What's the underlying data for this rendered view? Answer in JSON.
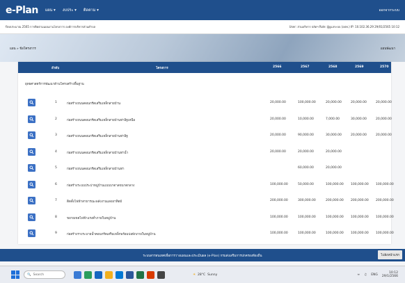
{
  "app": {
    "logo": "e-Plan",
    "nav": [
      "แผน",
      "งบประ",
      "ติดตาม"
    ],
    "top_right": "ออกจากระบบ"
  },
  "info": {
    "left": "ปีงบประมาณ 2565   การติดตามแผนงานโครงการ องค์การบริหารส่วนตำบล",
    "right": "User: ส่วนบริหาร ปลัดฯ  Role: ผู้ดูแลระบบ (อปท.)  IP: 10.102.36.29  29/01/2565 10:12"
  },
  "breadcrumb": {
    "left": "แผน » ข้อโครงการ",
    "right": "แผนพัฒนา"
  },
  "table": {
    "headers": {
      "seq": "ลำดับ",
      "name": "โครงการ",
      "y1": "2566",
      "y2": "2567",
      "y3": "2568",
      "y4": "2569",
      "y5": "2570"
    },
    "group_label": "ยุทธศาสตร์การพัฒนาด้านโครงสร้างพื้นฐาน",
    "rows": [
      {
        "no": "1",
        "name": "ก่อสร้างถนนคอนกรีตเสริมเหล็กสายบ้าน",
        "v1": "20,000.00",
        "v2": "100,000.00",
        "v3": "20,000.00",
        "v4": "20,000.00",
        "v5": "20,000.00"
      },
      {
        "no": "2",
        "name": "ก่อสร้างถนนคอนกรีตเสริมเหล็กสายบ้านท่าอิฐเหนือ",
        "v1": "20,000.00",
        "v2": "10,000.00",
        "v3": "7,000.00",
        "v4": "30,000.00",
        "v5": "20,000.00"
      },
      {
        "no": "3",
        "name": "ก่อสร้างถนนคอนกรีตเสริมเหล็กสายบ้านท่าอิฐ",
        "v1": "20,000.00",
        "v2": "90,000.00",
        "v3": "30,000.00",
        "v4": "20,000.00",
        "v5": "20,000.00"
      },
      {
        "no": "4",
        "name": "ก่อสร้างถนนคอนกรีตเสริมเหล็กสายบ้านท่าน้ำ",
        "v1": "20,000.00",
        "v2": "20,000.00",
        "v3": "20,000.00",
        "v4": "",
        "v5": ""
      },
      {
        "no": "5",
        "name": "ก่อสร้างถนนคอนกรีตเสริมเหล็กสายบ้านท่า",
        "v1": "",
        "v2": "60,000.00",
        "v3": "20,000.00",
        "v4": "",
        "v5": ""
      },
      {
        "no": "6",
        "name": "ก่อสร้างระบบประปาหมู่บ้านแบบบาดาลขนาดกลาง",
        "v1": "100,000.00",
        "v2": "50,000.00",
        "v3": "100,000.00",
        "v4": "100,000.00",
        "v5": "100,000.00"
      },
      {
        "no": "7",
        "name": "ติดตั้งไฟฟ้าสาธารณะพลังงานแสงอาทิตย์",
        "v1": "200,000.00",
        "v2": "300,000.00",
        "v3": "200,000.00",
        "v4": "200,000.00",
        "v5": "200,000.00"
      },
      {
        "no": "8",
        "name": "ขยายเขตไฟฟ้าแรงต่ำภายในหมู่บ้าน",
        "v1": "100,000.00",
        "v2": "100,000.00",
        "v3": "100,000.00",
        "v4": "100,000.00",
        "v5": "100,000.00"
      },
      {
        "no": "9",
        "name": "ก่อสร้างรางระบายน้ำคอนกรีตเสริมเหล็กพร้อมบ่อพักภายในหมู่บ้าน",
        "v1": "100,000.00",
        "v2": "100,000.00",
        "v3": "100,000.00",
        "v4": "100,000.00",
        "v5": "100,000.00"
      }
    ]
  },
  "footer": {
    "text": "ระบบสารสนเทศเพื่อการวางแผนและประเมินผล (e-Plan)  กรมส่งเสริมการปกครองท้องถิ่น",
    "button": "ไปยังหน้าแรก"
  },
  "taskbar": {
    "search_placeholder": "Search",
    "weather_temp": "28°C",
    "weather_label": "Sunny",
    "tray_lang": "ENG",
    "clock_time": "10:12",
    "clock_date": "29/1/2566"
  },
  "colors": {
    "primary": "#1f4f8c",
    "view_button": "#3b70c4"
  }
}
